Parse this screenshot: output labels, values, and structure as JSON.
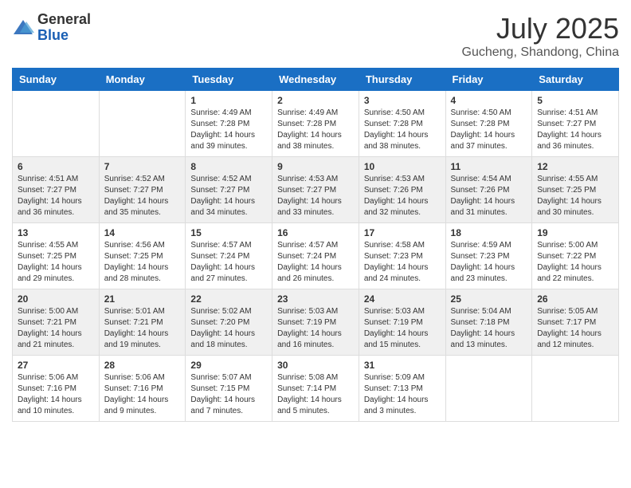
{
  "logo": {
    "general": "General",
    "blue": "Blue"
  },
  "title": {
    "month_year": "July 2025",
    "location": "Gucheng, Shandong, China"
  },
  "headers": [
    "Sunday",
    "Monday",
    "Tuesday",
    "Wednesday",
    "Thursday",
    "Friday",
    "Saturday"
  ],
  "weeks": [
    [
      {
        "day": "",
        "info": ""
      },
      {
        "day": "",
        "info": ""
      },
      {
        "day": "1",
        "info": "Sunrise: 4:49 AM\nSunset: 7:28 PM\nDaylight: 14 hours and 39 minutes."
      },
      {
        "day": "2",
        "info": "Sunrise: 4:49 AM\nSunset: 7:28 PM\nDaylight: 14 hours and 38 minutes."
      },
      {
        "day": "3",
        "info": "Sunrise: 4:50 AM\nSunset: 7:28 PM\nDaylight: 14 hours and 38 minutes."
      },
      {
        "day": "4",
        "info": "Sunrise: 4:50 AM\nSunset: 7:28 PM\nDaylight: 14 hours and 37 minutes."
      },
      {
        "day": "5",
        "info": "Sunrise: 4:51 AM\nSunset: 7:27 PM\nDaylight: 14 hours and 36 minutes."
      }
    ],
    [
      {
        "day": "6",
        "info": "Sunrise: 4:51 AM\nSunset: 7:27 PM\nDaylight: 14 hours and 36 minutes."
      },
      {
        "day": "7",
        "info": "Sunrise: 4:52 AM\nSunset: 7:27 PM\nDaylight: 14 hours and 35 minutes."
      },
      {
        "day": "8",
        "info": "Sunrise: 4:52 AM\nSunset: 7:27 PM\nDaylight: 14 hours and 34 minutes."
      },
      {
        "day": "9",
        "info": "Sunrise: 4:53 AM\nSunset: 7:27 PM\nDaylight: 14 hours and 33 minutes."
      },
      {
        "day": "10",
        "info": "Sunrise: 4:53 AM\nSunset: 7:26 PM\nDaylight: 14 hours and 32 minutes."
      },
      {
        "day": "11",
        "info": "Sunrise: 4:54 AM\nSunset: 7:26 PM\nDaylight: 14 hours and 31 minutes."
      },
      {
        "day": "12",
        "info": "Sunrise: 4:55 AM\nSunset: 7:25 PM\nDaylight: 14 hours and 30 minutes."
      }
    ],
    [
      {
        "day": "13",
        "info": "Sunrise: 4:55 AM\nSunset: 7:25 PM\nDaylight: 14 hours and 29 minutes."
      },
      {
        "day": "14",
        "info": "Sunrise: 4:56 AM\nSunset: 7:25 PM\nDaylight: 14 hours and 28 minutes."
      },
      {
        "day": "15",
        "info": "Sunrise: 4:57 AM\nSunset: 7:24 PM\nDaylight: 14 hours and 27 minutes."
      },
      {
        "day": "16",
        "info": "Sunrise: 4:57 AM\nSunset: 7:24 PM\nDaylight: 14 hours and 26 minutes."
      },
      {
        "day": "17",
        "info": "Sunrise: 4:58 AM\nSunset: 7:23 PM\nDaylight: 14 hours and 24 minutes."
      },
      {
        "day": "18",
        "info": "Sunrise: 4:59 AM\nSunset: 7:23 PM\nDaylight: 14 hours and 23 minutes."
      },
      {
        "day": "19",
        "info": "Sunrise: 5:00 AM\nSunset: 7:22 PM\nDaylight: 14 hours and 22 minutes."
      }
    ],
    [
      {
        "day": "20",
        "info": "Sunrise: 5:00 AM\nSunset: 7:21 PM\nDaylight: 14 hours and 21 minutes."
      },
      {
        "day": "21",
        "info": "Sunrise: 5:01 AM\nSunset: 7:21 PM\nDaylight: 14 hours and 19 minutes."
      },
      {
        "day": "22",
        "info": "Sunrise: 5:02 AM\nSunset: 7:20 PM\nDaylight: 14 hours and 18 minutes."
      },
      {
        "day": "23",
        "info": "Sunrise: 5:03 AM\nSunset: 7:19 PM\nDaylight: 14 hours and 16 minutes."
      },
      {
        "day": "24",
        "info": "Sunrise: 5:03 AM\nSunset: 7:19 PM\nDaylight: 14 hours and 15 minutes."
      },
      {
        "day": "25",
        "info": "Sunrise: 5:04 AM\nSunset: 7:18 PM\nDaylight: 14 hours and 13 minutes."
      },
      {
        "day": "26",
        "info": "Sunrise: 5:05 AM\nSunset: 7:17 PM\nDaylight: 14 hours and 12 minutes."
      }
    ],
    [
      {
        "day": "27",
        "info": "Sunrise: 5:06 AM\nSunset: 7:16 PM\nDaylight: 14 hours and 10 minutes."
      },
      {
        "day": "28",
        "info": "Sunrise: 5:06 AM\nSunset: 7:16 PM\nDaylight: 14 hours and 9 minutes."
      },
      {
        "day": "29",
        "info": "Sunrise: 5:07 AM\nSunset: 7:15 PM\nDaylight: 14 hours and 7 minutes."
      },
      {
        "day": "30",
        "info": "Sunrise: 5:08 AM\nSunset: 7:14 PM\nDaylight: 14 hours and 5 minutes."
      },
      {
        "day": "31",
        "info": "Sunrise: 5:09 AM\nSunset: 7:13 PM\nDaylight: 14 hours and 3 minutes."
      },
      {
        "day": "",
        "info": ""
      },
      {
        "day": "",
        "info": ""
      }
    ]
  ]
}
